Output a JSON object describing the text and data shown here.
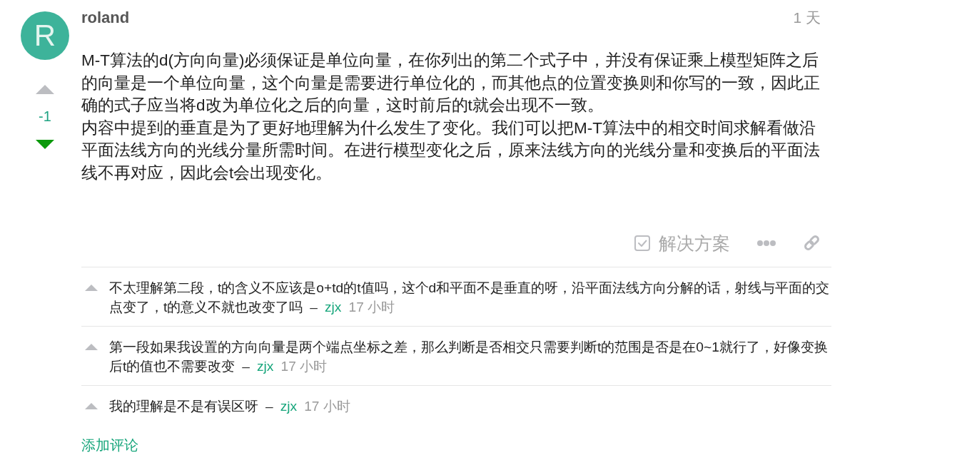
{
  "post": {
    "avatar": "R",
    "author": "roland",
    "time": "1 天",
    "votes": {
      "upvoted": false,
      "count": "-1",
      "downvoted": true
    },
    "body": [
      "M-T算法的d(方向向量)必须保证是单位向量，在你列出的第二个式子中，并没有保证乘上模型矩阵之后的向量是一个单位向量，这个向量是需要进行单位化的，而其他点的位置变换则和你写的一致，因此正确的式子应当将d改为单位化之后的向量，这时前后的t就会出现不一致。",
      "内容中提到的垂直是为了更好地理解为什么发生了变化。我们可以把M-T算法中的相交时间求解看做沿平面法线方向的光线分量所需时间。在进行模型变化之后，原来法线方向的光线分量和变换后的平面法线不再对应，因此会t会出现变化。"
    ],
    "actions": [
      {
        "kind": "solution",
        "label": "解决方案"
      },
      {
        "kind": "more"
      },
      {
        "kind": "link"
      }
    ]
  },
  "comments": [
    {
      "upvoted": false,
      "text": "不太理解第二段，t的含义不应该是o+td的t值吗，这个d和平面不是垂直的呀，沿平面法线方向分解的话，射线与平面的交点变了，t的意义不就也改变了吗",
      "separator": "–",
      "author": "zjx",
      "time": "17 小时"
    },
    {
      "upvoted": false,
      "text": "第一段如果我设置的方向向量是两个端点坐标之差，那么判断是否相交只需要判断t的范围是否是在0~1就行了，好像变换后t的值也不需要改变",
      "separator": "–",
      "author": "zjx",
      "time": "17 小时"
    },
    {
      "upvoted": false,
      "text": "我的理解是不是有误区呀",
      "separator": "–",
      "author": "zjx",
      "time": "17 小时"
    }
  ],
  "add_comment": "添加评论"
}
